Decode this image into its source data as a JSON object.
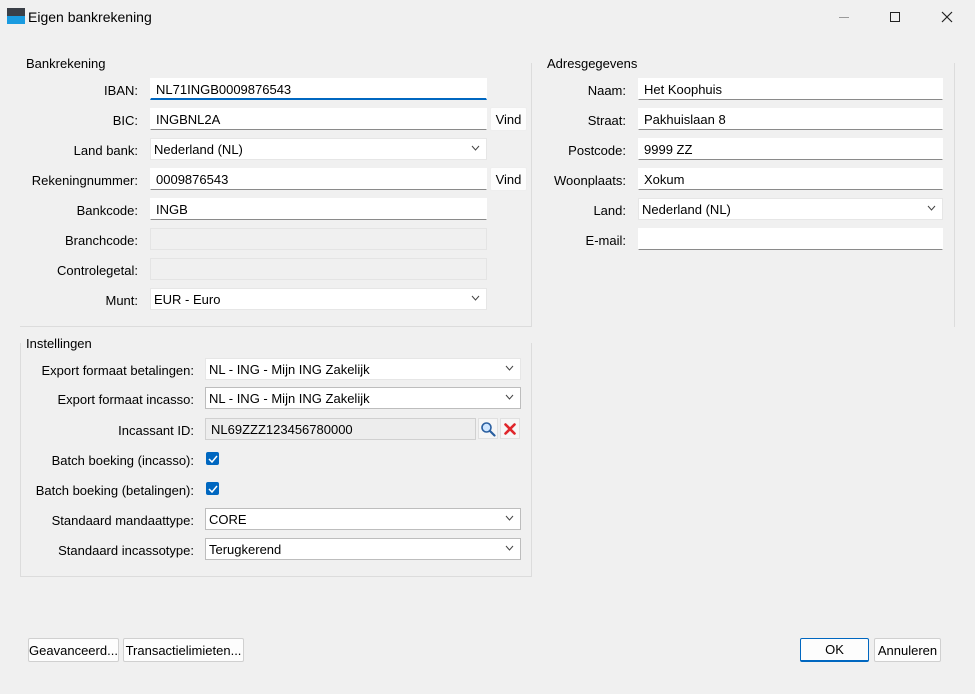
{
  "window": {
    "title": "Eigen bankrekening",
    "accent": "#0067c0"
  },
  "bankrekening": {
    "group_title": "Bankrekening",
    "iban_label": "IBAN:",
    "iban_value": "NL71INGB0009876543",
    "bic_label": "BIC:",
    "bic_value": "INGBNL2A",
    "vind_label": "Vind",
    "land_bank_label": "Land bank:",
    "land_bank_value": "Nederland (NL)",
    "rekeningnummer_label": "Rekeningnummer:",
    "rekeningnummer_value": "0009876543",
    "vind2_label": "Vind",
    "bankcode_label": "Bankcode:",
    "bankcode_value": "INGB",
    "branchcode_label": "Branchcode:",
    "branchcode_value": "",
    "controlegetal_label": "Controlegetal:",
    "controlegetal_value": "",
    "munt_label": "Munt:",
    "munt_value": "EUR - Euro"
  },
  "adres": {
    "group_title": "Adresgegevens",
    "naam_label": "Naam:",
    "naam_value": "Het Koophuis",
    "straat_label": "Straat:",
    "straat_value": "Pakhuislaan 8",
    "postcode_label": "Postcode:",
    "postcode_value": "9999 ZZ",
    "woonplaats_label": "Woonplaats:",
    "woonplaats_value": "Xokum",
    "land_label": "Land:",
    "land_value": "Nederland (NL)",
    "email_label": "E-mail:",
    "email_value": ""
  },
  "instellingen": {
    "group_title": "Instellingen",
    "export_betalingen_label": "Export formaat betalingen:",
    "export_betalingen_value": "NL - ING - Mijn ING Zakelijk",
    "export_incasso_label": "Export formaat incasso:",
    "export_incasso_value": "NL - ING - Mijn ING Zakelijk",
    "incassant_label": "Incassant ID:",
    "incassant_value": "NL69ZZZ123456780000",
    "batch_incasso_label": "Batch boeking (incasso):",
    "batch_incasso_checked": true,
    "batch_betalingen_label": "Batch boeking (betalingen):",
    "batch_betalingen_checked": true,
    "mandaattype_label": "Standaard mandaattype:",
    "mandaattype_value": "CORE",
    "incassotype_label": "Standaard incassotype:",
    "incassotype_value": "Terugkerend"
  },
  "footer": {
    "geavanceerd_label": "Geavanceerd...",
    "transactielimieten_label": "Transactielimieten...",
    "ok_label": "OK",
    "annuleren_label": "Annuleren"
  }
}
